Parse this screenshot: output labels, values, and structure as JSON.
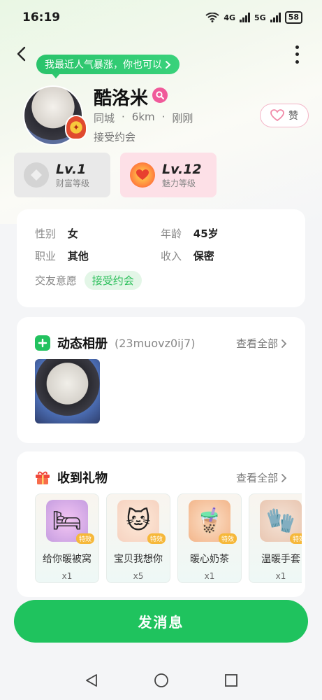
{
  "status_bar": {
    "time": "16:19",
    "network_1": "4G",
    "network_2": "5G",
    "battery": "58"
  },
  "header": {
    "tip_text": "我最近人气暴涨，你也可以",
    "nickname": "酷洛米",
    "meta": [
      "同城",
      "·",
      "6km",
      "·",
      "刚刚"
    ],
    "sub": "接受约会",
    "like_label": "赞"
  },
  "levels": {
    "wealth": {
      "level": "Lv.1",
      "label": "财富等级"
    },
    "charm": {
      "level": "Lv.12",
      "label": "魅力等级"
    }
  },
  "info": {
    "gender_key": "性别",
    "gender_val": "女",
    "age_key": "年龄",
    "age_val": "45岁",
    "job_key": "职业",
    "job_val": "其他",
    "income_key": "收入",
    "income_val": "保密",
    "intent_key": "交友意愿",
    "intent_val": "接受约会"
  },
  "album": {
    "title": "动态相册",
    "sub": "(23muovz0ij7)",
    "view_all": "查看全部"
  },
  "gifts": {
    "title": "收到礼物",
    "view_all": "查看全部",
    "items": [
      {
        "name": "给你暖被窝",
        "count": "x1",
        "tag": "特效"
      },
      {
        "name": "宝贝我想你",
        "count": "x5",
        "tag": "特效"
      },
      {
        "name": "暖心奶茶",
        "count": "x1",
        "tag": "特效"
      },
      {
        "name": "温暖手套",
        "count": "x1",
        "tag": "特效"
      }
    ]
  },
  "send_button": "发消息",
  "colors": {
    "accent_green": "#1fc35e",
    "charm_pink": "#fde0e7",
    "tag_green": "#2bbf5a"
  }
}
